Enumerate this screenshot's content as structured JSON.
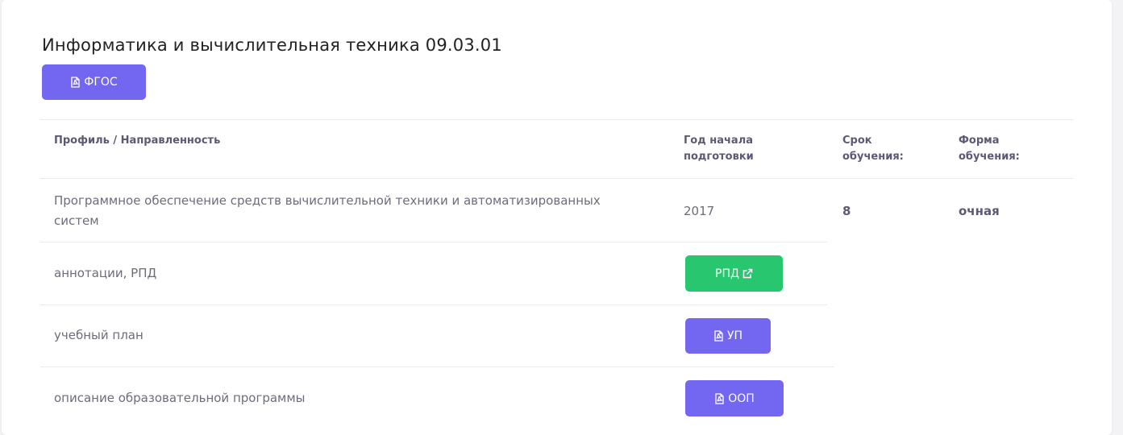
{
  "program": {
    "title": "Информатика и вычислительная техника 09.03.01",
    "fgos_button": "ФГОС"
  },
  "table": {
    "headers": {
      "profile": "Профиль / Направленность",
      "start_year_line1": "Год начала",
      "start_year_line2": "подготовки",
      "duration_line1": "Срок",
      "duration_line2": "обучения:",
      "form_line1": "Форма",
      "form_line2": "обучения:"
    },
    "profile_row": {
      "name_line1": "Программное обеспечение средств вычислительной техники и автоматизированных",
      "name_line2": "систем",
      "start_year": "2017",
      "duration": "8",
      "form": "очная"
    },
    "documents": [
      {
        "label": "аннотации, РПД",
        "button": "РПД",
        "icon": "external-link-icon",
        "color": "#28c76f"
      },
      {
        "label": "учебный план",
        "button": "УП",
        "icon": "pdf-file-icon",
        "color": "#7366f0"
      },
      {
        "label": "описание образовательной программы",
        "button": "ООП",
        "icon": "pdf-file-icon",
        "color": "#7366f0"
      }
    ]
  },
  "colors": {
    "primary": "#7366f0",
    "success": "#28c76f"
  }
}
